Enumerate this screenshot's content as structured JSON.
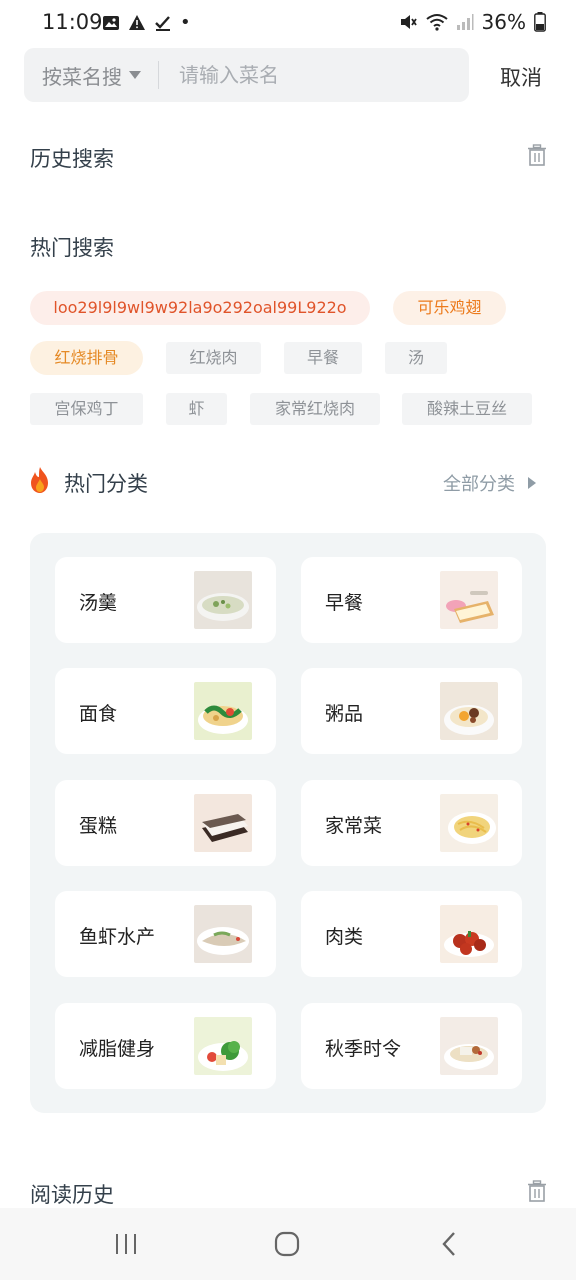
{
  "status": {
    "time": "11:09",
    "battery": "36%"
  },
  "search": {
    "mode": "按菜名搜",
    "placeholder": "请输入菜名",
    "cancel": "取消"
  },
  "history": {
    "title": "历史搜索"
  },
  "hot": {
    "title": "热门搜索",
    "tags": [
      "loo29l9l9wl9w92la9o292oal99L922o",
      "可乐鸡翅",
      "红烧排骨",
      "红烧肉",
      "早餐",
      "汤",
      "宫保鸡丁",
      "虾",
      "家常红烧肉",
      "酸辣土豆丝"
    ]
  },
  "categories": {
    "title": "热门分类",
    "all": "全部分类",
    "items": [
      "汤羹",
      "早餐",
      "面食",
      "粥品",
      "蛋糕",
      "家常菜",
      "鱼虾水产",
      "肉类",
      "减脂健身",
      "秋季时令"
    ]
  },
  "reading": {
    "title": "阅读历史"
  },
  "colors": {
    "accent": "#e0542a",
    "panel": "#f2f5f6",
    "text": "#34404b"
  }
}
